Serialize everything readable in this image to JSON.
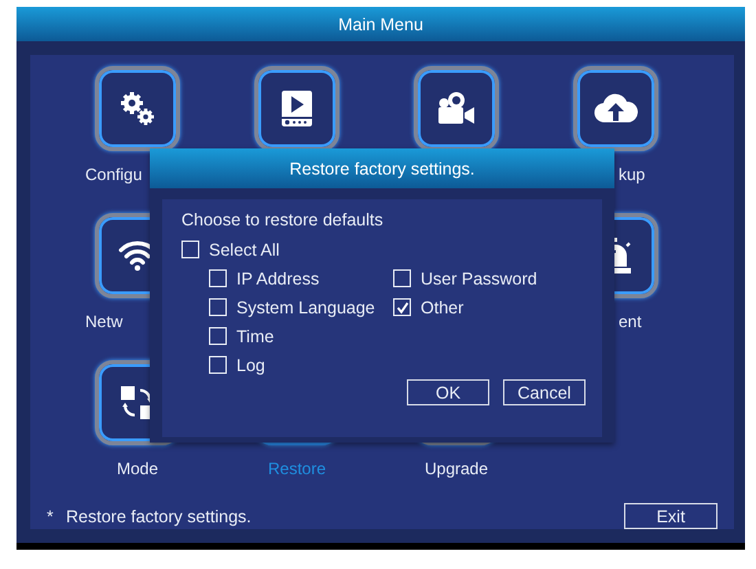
{
  "window": {
    "title": "Main Menu"
  },
  "menu_rows": [
    {
      "tiles": [
        {
          "kind": "gears",
          "label": "Configu",
          "selected": false
        },
        {
          "kind": "player",
          "selected": false
        },
        {
          "kind": "camera",
          "selected": false
        },
        {
          "kind": "cloud",
          "label": "kup",
          "selected": false
        }
      ]
    },
    {
      "tiles": [
        {
          "kind": "wifi",
          "label": "Netw",
          "selected": false
        },
        {
          "kind": "alarm",
          "label": "ent",
          "selected": false
        }
      ]
    },
    {
      "tiles": [
        {
          "kind": "mode",
          "label": "Mode",
          "selected": false
        },
        {
          "kind": "plain",
          "label": "Restore",
          "selected": true
        },
        {
          "kind": "plain",
          "label": "Upgrade",
          "selected": false
        }
      ]
    }
  ],
  "footer": {
    "marker": "*",
    "note": "Restore factory settings.",
    "exit_button": "Exit"
  },
  "dialog": {
    "title": "Restore factory settings.",
    "heading": "Choose to restore defaults",
    "select_all": {
      "label": "Select All",
      "checked": false
    },
    "option_columns": [
      {
        "options": [
          {
            "label": "IP Address",
            "checked": false
          },
          {
            "label": "System Language",
            "checked": false
          },
          {
            "label": "Time",
            "checked": false
          },
          {
            "label": "Log",
            "checked": false
          }
        ]
      },
      {
        "options": [
          {
            "label": "User Password",
            "checked": false
          },
          {
            "label": "Other",
            "checked": true
          }
        ]
      }
    ],
    "buttons": [
      "OK",
      "Cancel"
    ]
  }
}
